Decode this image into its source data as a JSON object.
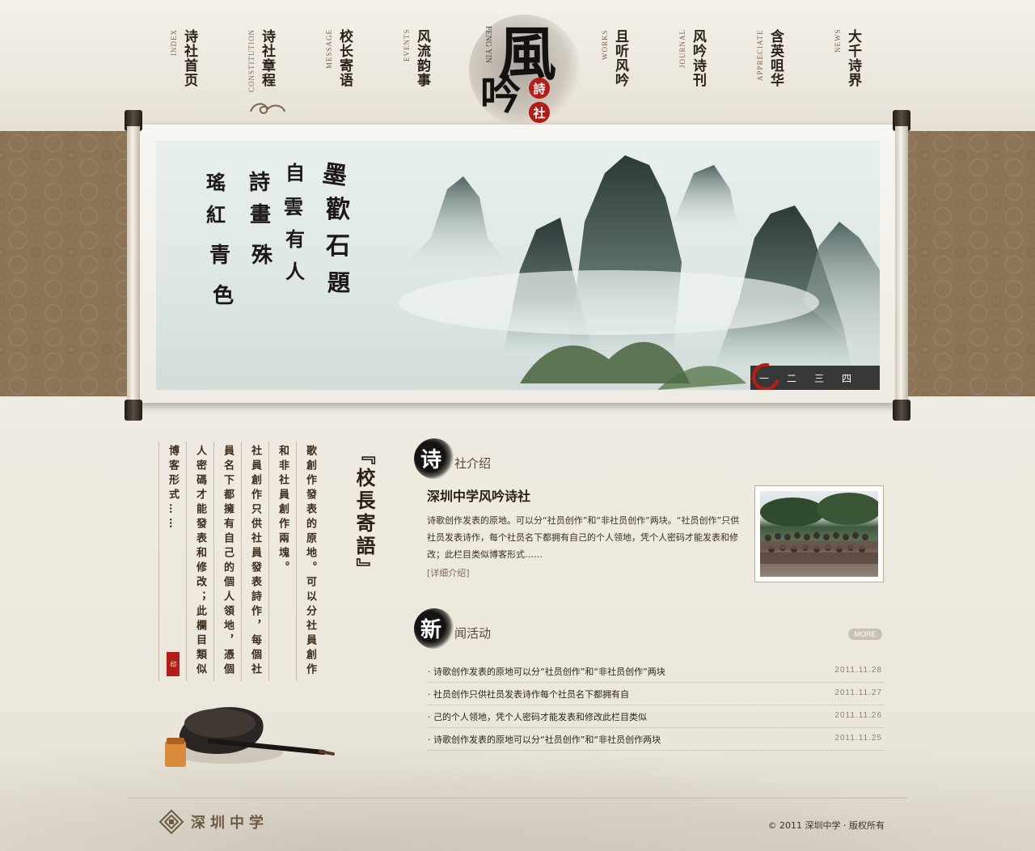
{
  "colors": {
    "band": "#8c7457",
    "ink": "#141210",
    "seal": "#b21d16",
    "paper": "#efebe2"
  },
  "logo": {
    "big1": "風",
    "big2": "吟",
    "seal1": "詩",
    "seal2": "社",
    "en": "FENG YIN"
  },
  "nav": [
    {
      "en": "INDEX",
      "zh": "诗社首页"
    },
    {
      "en": "CONSTITUTION",
      "zh": "诗社章程"
    },
    {
      "en": "MESSAGE",
      "zh": "校长寄语"
    },
    {
      "en": "EVENTS",
      "zh": "风流韵事"
    },
    {
      "en": "WORKS",
      "zh": "且听风吟"
    },
    {
      "en": "JOURNAL",
      "zh": "风吟诗刊"
    },
    {
      "en": "APPRECIATE",
      "zh": "含英咀华"
    },
    {
      "en": "NEWS",
      "zh": "大千诗界"
    }
  ],
  "slider": {
    "dots": [
      "一",
      "二",
      "三",
      "四"
    ],
    "active_index": 0
  },
  "message": {
    "title": "『校長寄語』",
    "columns": [
      "歌創作發表的原地。可以分社員創作",
      "和非社員創作兩塊。",
      "社員創作只供社員發表詩作，每個社",
      "員名下都擁有自己的個人領地，憑個",
      "人密碼才能發表和修改；此欄目類似",
      "博客形式……"
    ],
    "seal": "印"
  },
  "intro": {
    "head_big": "诗",
    "head_small": "社介绍",
    "title": "深圳中学风吟诗社",
    "text": "诗歌创作发表的原地。可以分“社员创作”和“非社员创作”两块。“社员创作”只供社员发表诗作，每个社员名下都拥有自己的个人领地，凭个人密码才能发表和修改；此栏目类似博客形式……",
    "more": "[详细介绍]"
  },
  "news": {
    "head_big": "新",
    "head_small": "闻活动",
    "more": "MORE",
    "items": [
      {
        "title": "· 诗歌创作发表的原地可以分“社员创作”和“非社员创作”两块",
        "date": "2011.11.28"
      },
      {
        "title": "· 社员创作只供社员发表诗作每个社员名下都拥有自",
        "date": "2011.11.27"
      },
      {
        "title": "· 己的个人领地，凭个人密码才能发表和修改此栏目类似",
        "date": "2011.11.26"
      },
      {
        "title": "· 诗歌创作发表的原地可以分“社员创作”和“非社员创作两块",
        "date": "2011.11.25"
      }
    ]
  },
  "footer": {
    "school": "深圳中学",
    "copyright": "© 2011  深圳中学 · 版权所有"
  }
}
